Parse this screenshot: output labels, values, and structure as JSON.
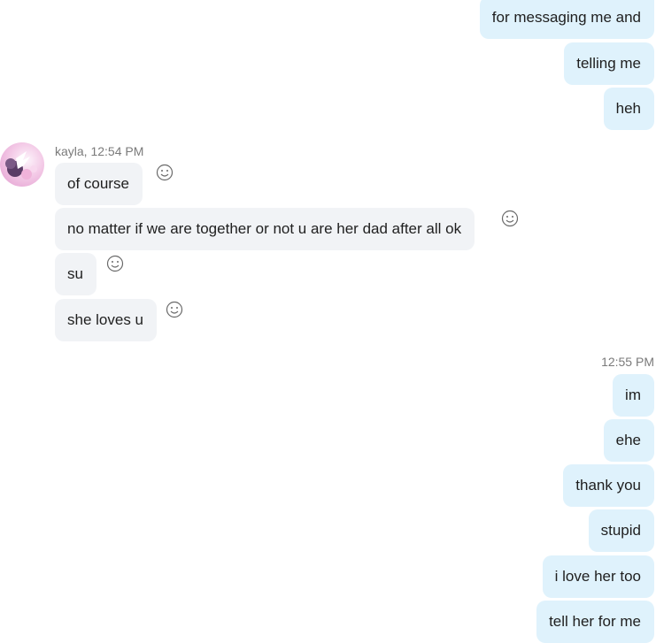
{
  "outgoing_top": [
    {
      "text": "for messaging me and"
    },
    {
      "text": "telling me"
    },
    {
      "text": "heh"
    }
  ],
  "incoming_group": {
    "sender_label": "kayla, 12:54 PM",
    "avatar_icon": "avatar-kayla",
    "messages": [
      {
        "text": "of course",
        "reaction_icon": "smiley-icon"
      },
      {
        "text": "no matter if we are together or not u are her dad after all ok",
        "reaction_icon": "smiley-icon"
      },
      {
        "text": "su",
        "reaction_icon": "smiley-icon"
      },
      {
        "text": "she loves u",
        "reaction_icon": "smiley-icon"
      }
    ]
  },
  "outgoing_group_2": {
    "timestamp": "12:55 PM",
    "messages": [
      {
        "text": "im"
      },
      {
        "text": "ehe"
      },
      {
        "text": "thank you"
      },
      {
        "text": "stupid"
      },
      {
        "text": "i love her too"
      },
      {
        "text": "tell her for me"
      }
    ]
  },
  "colors": {
    "outgoing_bubble": "#dff2fc",
    "incoming_bubble": "#f1f3f6",
    "meta_text": "#7a7a7a",
    "text": "#1f1f1f"
  }
}
